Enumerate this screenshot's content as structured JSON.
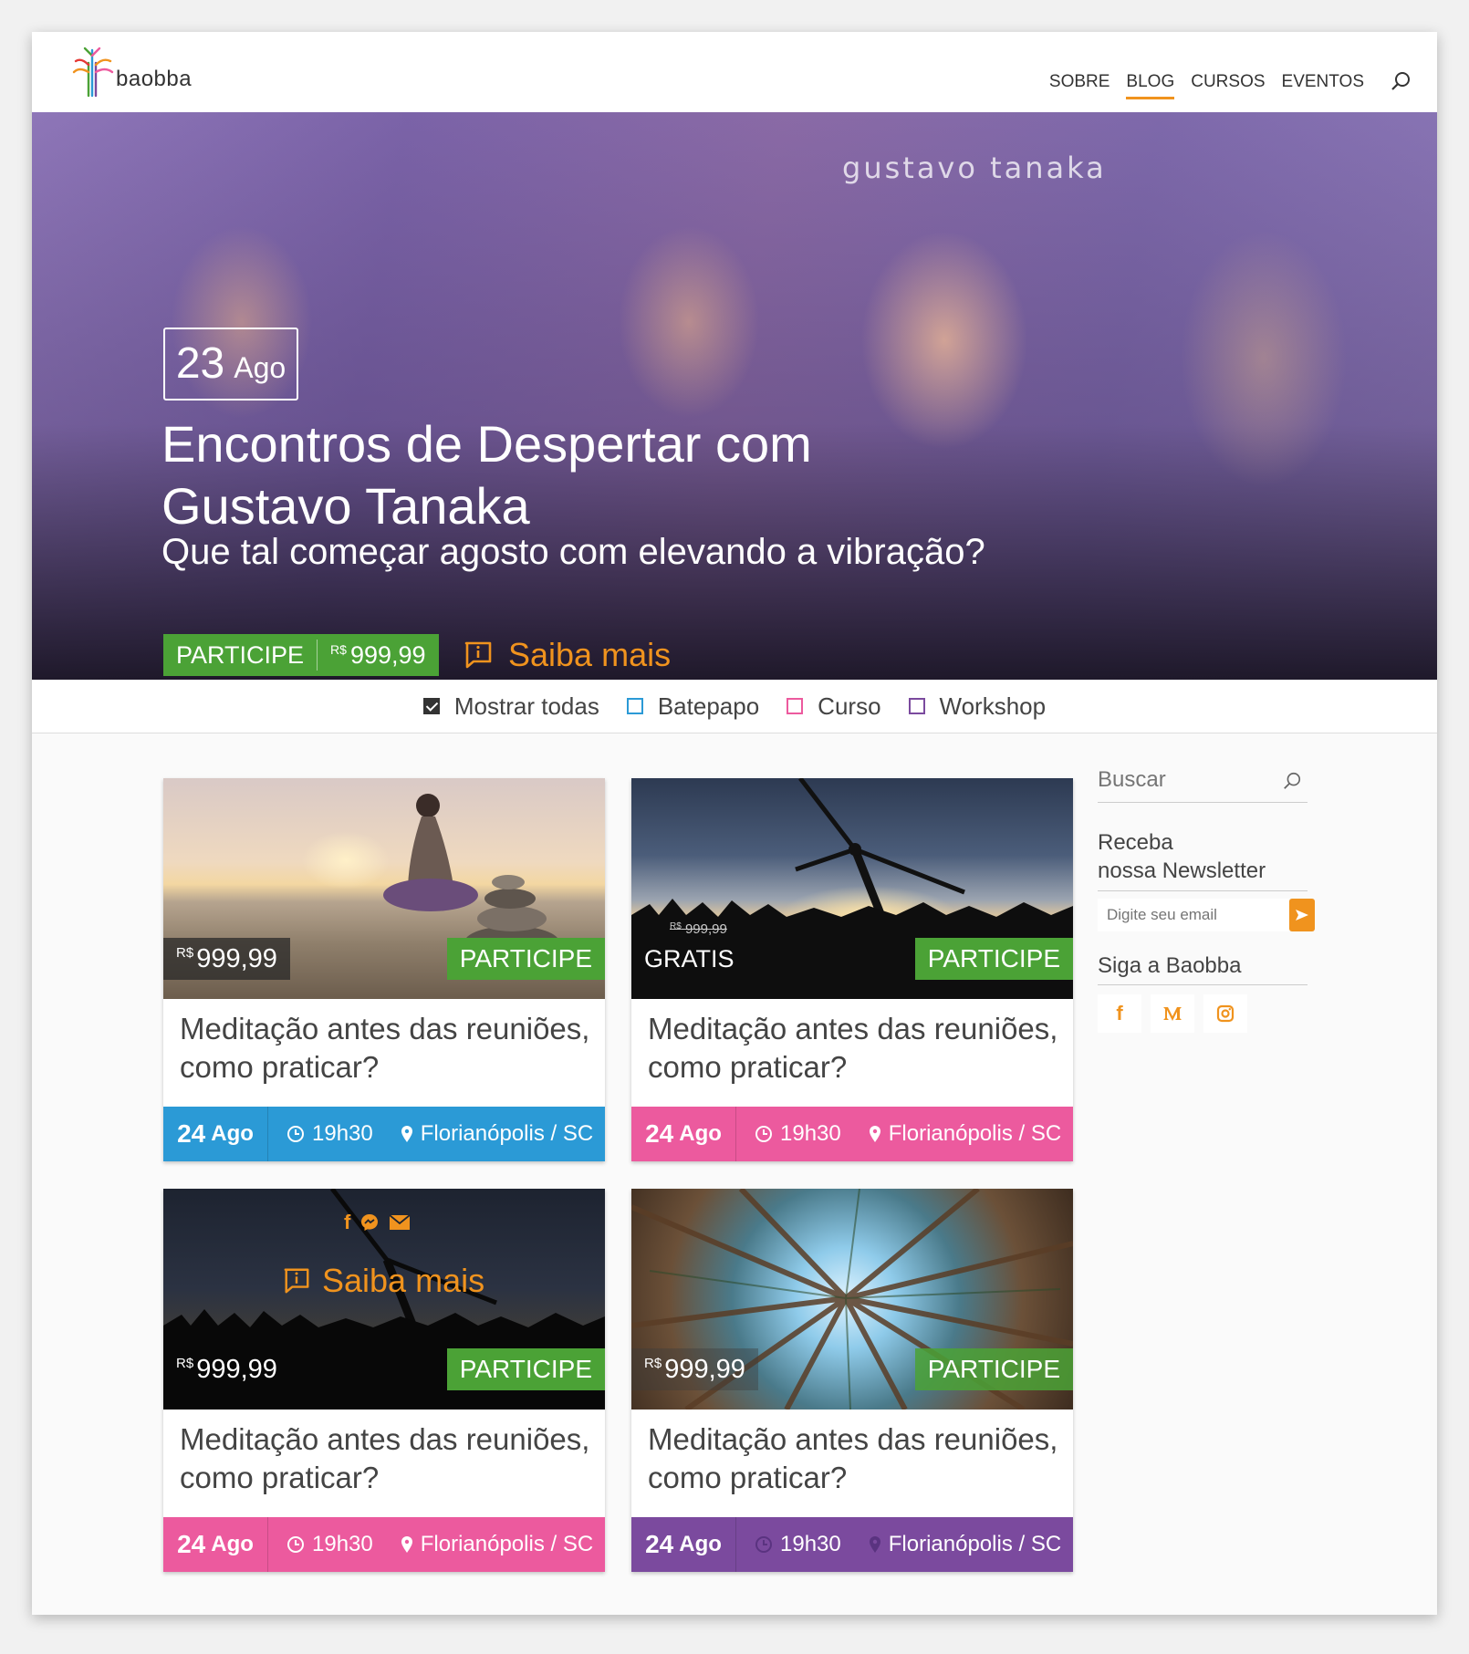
{
  "header": {
    "logo_text": "baobba",
    "nav": [
      "SOBRE",
      "BLOG",
      "CURSOS",
      "EVENTOS"
    ],
    "active_nav": "BLOG"
  },
  "hero": {
    "watermark": "gustavo tanaka",
    "date_day": "23",
    "date_month": "Ago",
    "title": "Encontros de Despertar com Gustavo Tanaka",
    "subtitle": "Que tal começar agosto com elevando a vibração?",
    "cta_label": "PARTICIPE",
    "currency": "R$",
    "price": "999,99",
    "more_label": "Saiba mais"
  },
  "filters": [
    {
      "label": "Mostrar todas",
      "checked": true,
      "color": "#333333"
    },
    {
      "label": "Batepapo",
      "checked": false,
      "color": "#2b9ad6"
    },
    {
      "label": "Curso",
      "checked": false,
      "color": "#ec5a9e"
    },
    {
      "label": "Workshop",
      "checked": false,
      "color": "#7b4a9e"
    }
  ],
  "cards": [
    {
      "image": "meditation-sunset",
      "currency": "R$",
      "price": "999,99",
      "cta": "PARTICIPE",
      "title": "Meditação antes das reuniões, como praticar?",
      "day": "24",
      "month": "Ago",
      "time": "19h30",
      "location": "Florianópolis / SC",
      "color": "#2b9ad6"
    },
    {
      "image": "wind-turbine-crowd",
      "old_currency": "R$",
      "old_price": "999,99",
      "price_label": "GRATIS",
      "cta": "PARTICIPE",
      "title": "Meditação antes das reuniões, como praticar?",
      "day": "24",
      "month": "Ago",
      "time": "19h30",
      "location": "Florianópolis / SC",
      "color": "#ec5a9e"
    },
    {
      "image": "wind-turbine-crowd-dark",
      "share_icons": [
        "facebook-icon",
        "messenger-icon",
        "mail-icon"
      ],
      "more_label": "Saiba mais",
      "currency": "R$",
      "price": "999,99",
      "cta": "PARTICIPE",
      "title": "Meditação antes das reuniões, como praticar?",
      "day": "24",
      "month": "Ago",
      "time": "19h30",
      "location": "Florianópolis / SC",
      "color": "#ec5a9e"
    },
    {
      "image": "forest-canopy",
      "currency": "R$",
      "price": "999,99",
      "cta": "PARTICIPE",
      "title": "Meditação antes das reuniões, como praticar?",
      "day": "24",
      "month": "Ago",
      "time": "19h30",
      "location": "Florianópolis / SC",
      "color": "#7b4a9e"
    }
  ],
  "sidebar": {
    "search_placeholder": "Buscar",
    "newsletter_line1": "Receba",
    "newsletter_line2": "nossa Newsletter",
    "email_placeholder": "Digite seu email",
    "follow_title": "Siga a Baobba",
    "socials": [
      "facebook-icon",
      "medium-icon",
      "instagram-icon"
    ]
  },
  "colors": {
    "accent": "#f0931e",
    "cta_green": "#4ba236"
  }
}
